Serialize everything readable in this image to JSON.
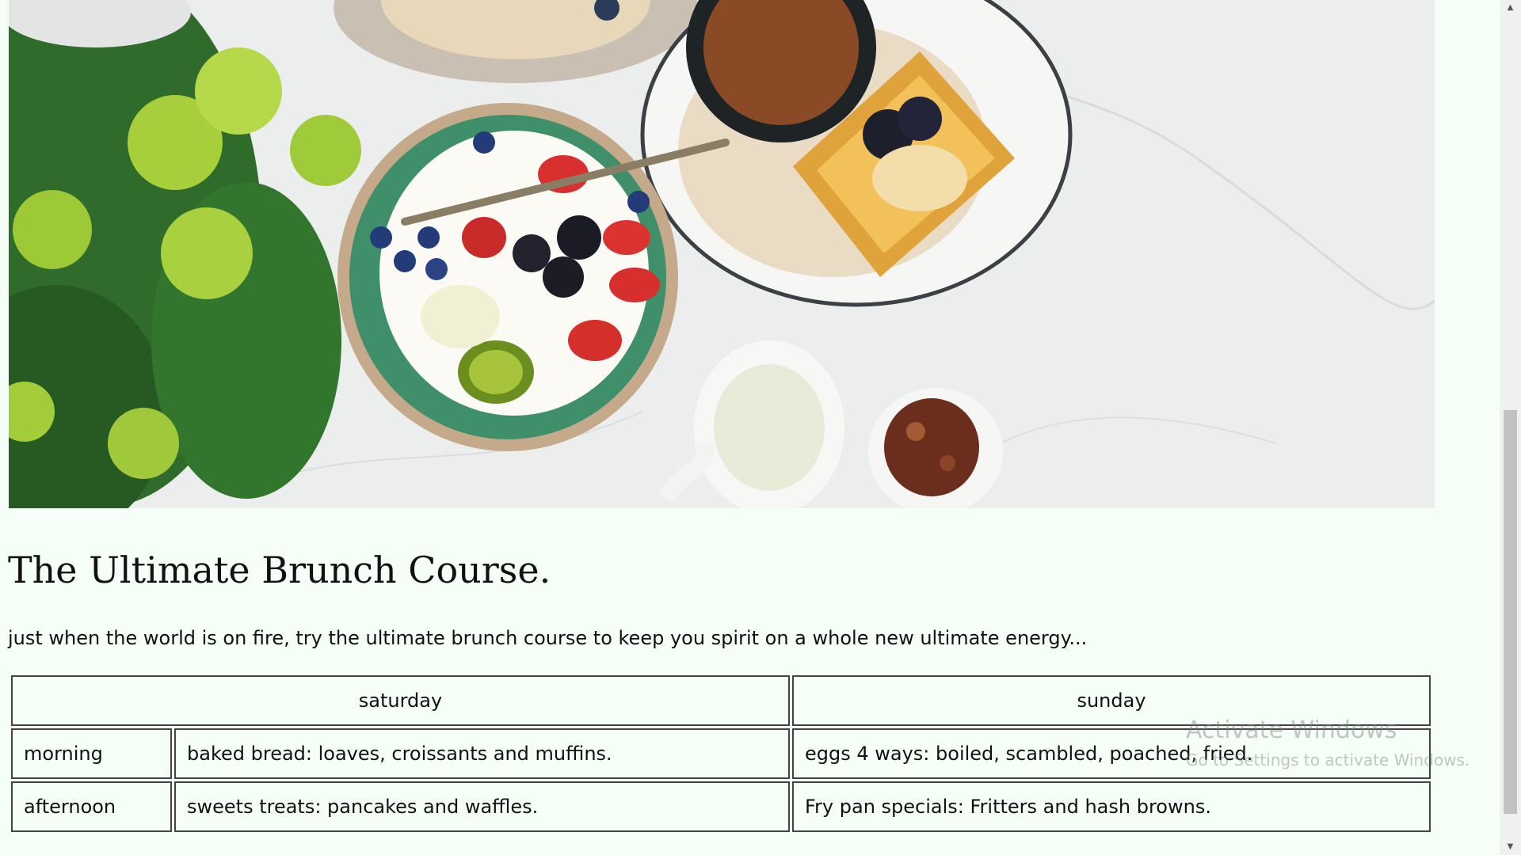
{
  "hero_image": {
    "subject": "brunch-table-photo"
  },
  "course": {
    "title": "The Ultimate Brunch Course.",
    "intro": "just when the world is on fire, try the ultimate brunch course to keep you spirit on a whole new ultimate energy..."
  },
  "schedule": {
    "headers": [
      "saturday",
      "sunday"
    ],
    "rows": [
      {
        "time": "morning",
        "saturday": "baked bread: loaves, croissants and muffins.",
        "sunday": "eggs 4 ways: boiled, scambled, poached, fried."
      },
      {
        "time": "afternoon",
        "saturday": "sweets treats: pancakes and waffles.",
        "sunday": "Fry pan specials: Fritters and hash browns."
      }
    ]
  },
  "watermark": {
    "line1": "Activate Windows",
    "line2": "Go to Settings to activate Windows."
  },
  "scrollbar": {
    "up_icon": "▲",
    "down_icon": "▼"
  },
  "colors": {
    "page_background": "#f5fff8",
    "table_border": "#444444"
  }
}
